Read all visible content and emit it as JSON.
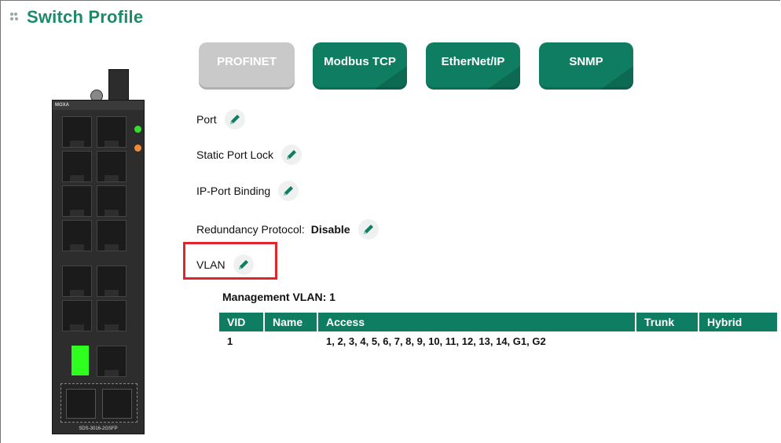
{
  "page": {
    "title": "Switch Profile"
  },
  "protocols": [
    {
      "label": "PROFINET",
      "state": "disabled"
    },
    {
      "label": "Modbus TCP",
      "state": "active"
    },
    {
      "label": "EtherNet/IP",
      "state": "active"
    },
    {
      "label": "SNMP",
      "state": "active"
    }
  ],
  "settings": {
    "port": {
      "label": "Port"
    },
    "static_port_lock": {
      "label": "Static Port Lock"
    },
    "ip_port_binding": {
      "label": "IP-Port Binding"
    },
    "redundancy": {
      "label": "Redundancy Protocol:",
      "value": "Disable"
    },
    "vlan": {
      "label": "VLAN"
    }
  },
  "vlan": {
    "management": "Management VLAN: 1",
    "columns": [
      "VID",
      "Name",
      "Access",
      "Trunk",
      "Hybrid"
    ],
    "rows": [
      {
        "vid": "1",
        "name": "",
        "access": "1, 2, 3, 4, 5, 6, 7, 8, 9, 10, 11, 12, 13, 14, G1, G2",
        "trunk": "",
        "hybrid": ""
      }
    ]
  },
  "device": {
    "brand": "MOXA",
    "model": "SDS-3016-2GSFP"
  },
  "colors": {
    "accent": "#0f7d61",
    "title": "#1d8a6a",
    "highlight": "#e0262b",
    "disabled": "#c9c9c9",
    "link_led": "#2fff1f"
  }
}
